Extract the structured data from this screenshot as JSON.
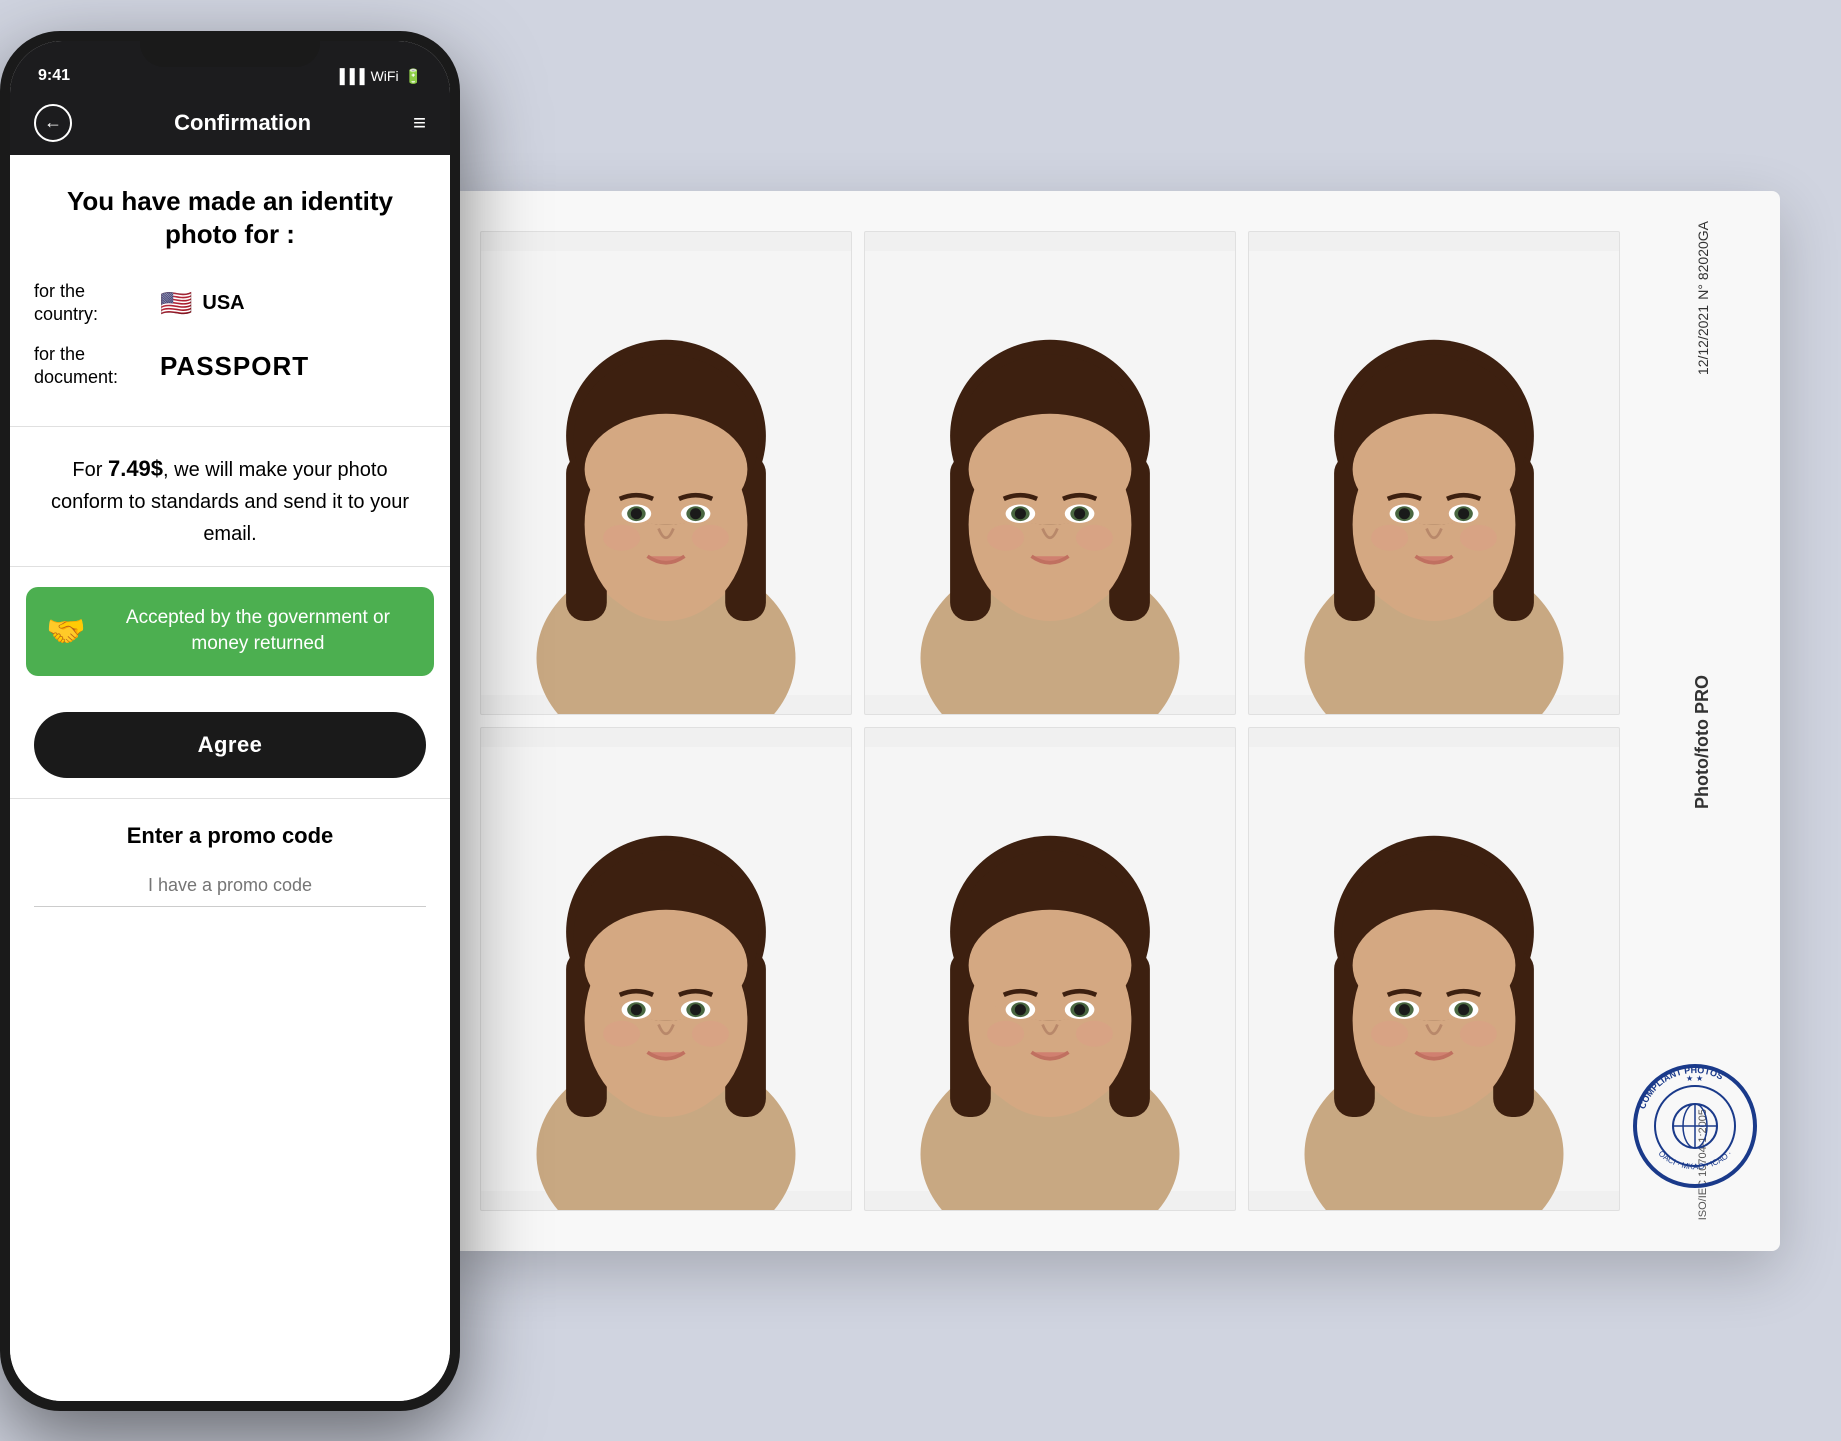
{
  "page": {
    "background_color": "#d0d4e0"
  },
  "phone": {
    "nav": {
      "title": "Confirmation",
      "back_label": "←",
      "menu_label": "☰"
    },
    "identity": {
      "title": "You have made an identity photo for :",
      "country_label": "for the country:",
      "country_value": "USA",
      "document_label": "for the document:",
      "document_value": "PASSPORT"
    },
    "price": {
      "text_prefix": "For ",
      "amount": "7.49$",
      "text_suffix": ", we will make your photo conform to standards and send it to your email."
    },
    "guarantee": {
      "icon": "🤝",
      "text": "Accepted by the government or money returned"
    },
    "agree_button": {
      "label": "Agree"
    },
    "promo": {
      "title": "Enter a promo code",
      "placeholder": "I have a promo code"
    }
  },
  "photo_sheet": {
    "number": "N° 82020GA",
    "date": "12/12/2021",
    "label": "Photo/foto PRO",
    "iso": "ISO/IEC 10704-1:2005",
    "stamp_text": "COMPLIANT PHOTOS",
    "stamp_inner": "OACI / MKAO"
  }
}
